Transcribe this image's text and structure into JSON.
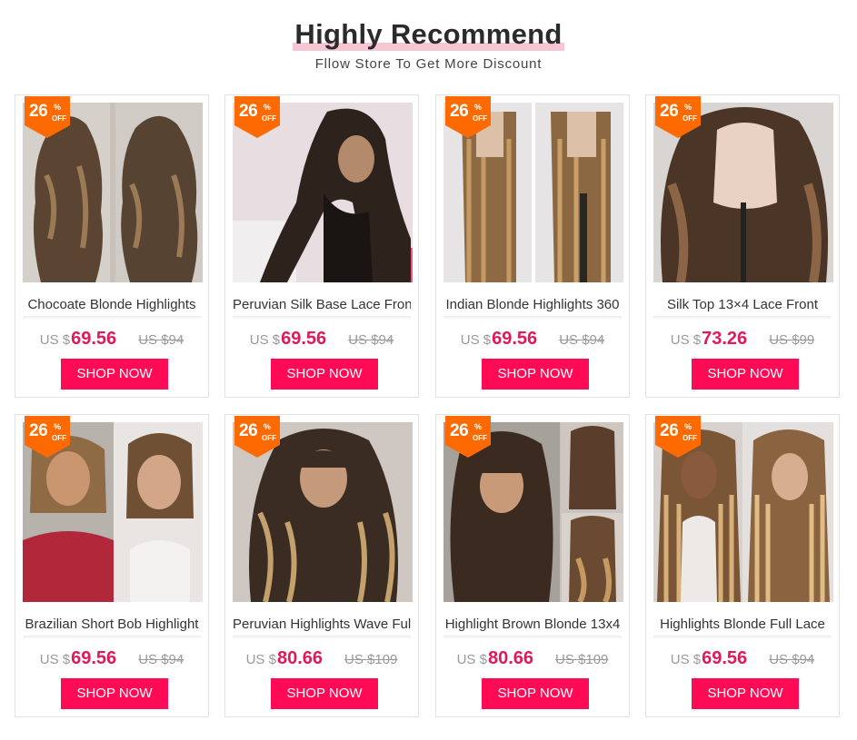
{
  "header": {
    "title": "Highly Recommend",
    "subtitle": "Fllow Store To Get More Discount"
  },
  "colors": {
    "accent": "#ff0a55",
    "price": "#e0195a",
    "badge": "#ff6a00",
    "title_highlight": "#f6c7d2"
  },
  "products": [
    {
      "discount": "26",
      "pct": "%",
      "off": "OFF",
      "name": "Chocoate Blonde Highlights",
      "currency": "US $",
      "price": "69.56",
      "old_price": "US $94",
      "button": "SHOP NOW"
    },
    {
      "discount": "26",
      "pct": "%",
      "off": "OFF",
      "name": "Peruvian Silk Base Lace Front",
      "currency": "US $",
      "price": "69.56",
      "old_price": "US $94",
      "button": "SHOP NOW"
    },
    {
      "discount": "26",
      "pct": "%",
      "off": "OFF",
      "name": "Indian Blonde Highlights 360",
      "currency": "US $",
      "price": "69.56",
      "old_price": "US $94",
      "button": "SHOP NOW"
    },
    {
      "discount": "26",
      "pct": "%",
      "off": "OFF",
      "name": "Silk Top 13×4 Lace Front",
      "currency": "US $",
      "price": "73.26",
      "old_price": "US $99",
      "button": "SHOP NOW"
    },
    {
      "discount": "26",
      "pct": "%",
      "off": "OFF",
      "name": "Brazilian Short Bob Highlight",
      "currency": "US $",
      "price": "69.56",
      "old_price": "US $94",
      "button": "SHOP NOW"
    },
    {
      "discount": "26",
      "pct": "%",
      "off": "OFF",
      "name": "Peruvian Highlights Wave Full",
      "currency": "US $",
      "price": "80.66",
      "old_price": "US $109",
      "button": "SHOP NOW"
    },
    {
      "discount": "26",
      "pct": "%",
      "off": "OFF",
      "name": "Highlight Brown Blonde 13x4",
      "currency": "US $",
      "price": "80.66",
      "old_price": "US $109",
      "button": "SHOP NOW"
    },
    {
      "discount": "26",
      "pct": "%",
      "off": "OFF",
      "name": "Highlights Blonde Full Lace",
      "currency": "US $",
      "price": "69.56",
      "old_price": "US $94",
      "button": "SHOP NOW"
    }
  ]
}
